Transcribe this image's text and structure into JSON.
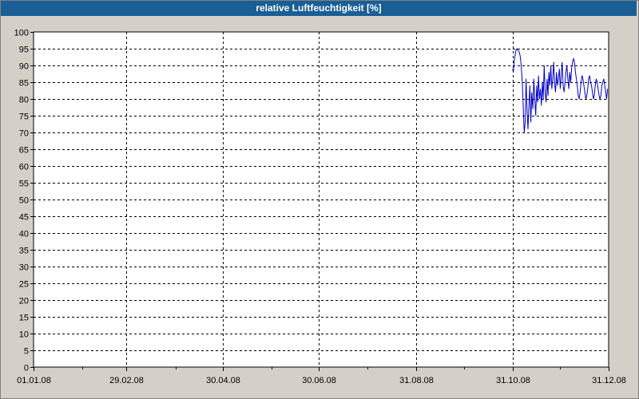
{
  "chart_data": {
    "type": "line",
    "title": "relative Luftfeuchtigkeit [%]",
    "xlabel": "",
    "ylabel": "",
    "ylim": [
      0,
      100
    ],
    "y_ticks": [
      0,
      5,
      10,
      15,
      20,
      25,
      30,
      35,
      40,
      45,
      50,
      55,
      60,
      65,
      70,
      75,
      80,
      85,
      90,
      95,
      100
    ],
    "x_tick_labels": [
      "01.01.08",
      "29.02.08",
      "30.04.08",
      "30.06.08",
      "31.08.08",
      "31.10.08",
      "31.12.08"
    ],
    "x_tick_days": [
      0,
      59,
      120,
      181,
      243,
      304,
      365
    ],
    "grid": true,
    "color": "#0000cc",
    "series": [
      {
        "name": "",
        "x_days": [
          304,
          304.5,
          305,
          305.6,
          306.2,
          306.8,
          307.5,
          308.2,
          308.8,
          309.3,
          309.8,
          310.3,
          310.9,
          311.4,
          312,
          312.6,
          313.2,
          313.8,
          314.4,
          315,
          315.6,
          316.2,
          316.9,
          317.5,
          318.1,
          318.7,
          319.3,
          319.9,
          320.5,
          321.1,
          321.7,
          322.3,
          322.9,
          323.5,
          324.1,
          324.7,
          325.3,
          325.9,
          326.5,
          327.1,
          327.7,
          328.3,
          328.9,
          329.5,
          330.1,
          330.7,
          331.3,
          331.9,
          332.5,
          333.1,
          333.7,
          334.3,
          334.9,
          335.5,
          336.1,
          336.7,
          337.3,
          337.9,
          338.5,
          339.1,
          339.7,
          340.3,
          340.9,
          341.5,
          342.1,
          342.7,
          343.3,
          343.9,
          344.5,
          345.1,
          345.7,
          346.3,
          346.9,
          347.5,
          348.1,
          348.7,
          349.3,
          349.9,
          350.5,
          351.1,
          351.7,
          352.3,
          352.9,
          353.5,
          354.1,
          354.7,
          355.3,
          355.9,
          356.5,
          357.1,
          357.7,
          358.3,
          358.9,
          359.5,
          360.1,
          360.7,
          361.3,
          361.9,
          362.5,
          363.1,
          363.7,
          364.3,
          365
        ],
        "values": [
          89,
          88,
          91,
          93,
          94.5,
          95,
          94.5,
          94,
          93,
          91,
          88,
          84,
          76,
          70,
          73,
          86,
          77,
          71,
          78,
          84,
          73,
          82,
          77,
          86,
          80,
          75,
          84,
          79,
          87,
          80,
          83,
          78,
          85,
          80,
          90,
          82,
          79,
          86,
          81,
          88,
          84,
          90,
          83,
          86,
          91,
          85,
          82,
          88,
          84,
          86,
          89,
          83,
          87,
          91,
          84,
          82,
          85,
          88,
          90,
          86,
          83,
          88,
          85,
          89,
          91,
          92,
          91,
          88,
          86,
          84,
          81,
          80,
          82,
          85,
          87,
          86,
          84,
          82,
          80,
          81,
          83,
          86,
          87,
          85,
          84,
          82,
          80,
          81,
          84,
          86,
          85,
          83,
          81,
          80,
          81,
          84,
          85,
          86,
          84,
          82,
          80,
          83
        ],
        "note_plot": ""
      }
    ]
  }
}
